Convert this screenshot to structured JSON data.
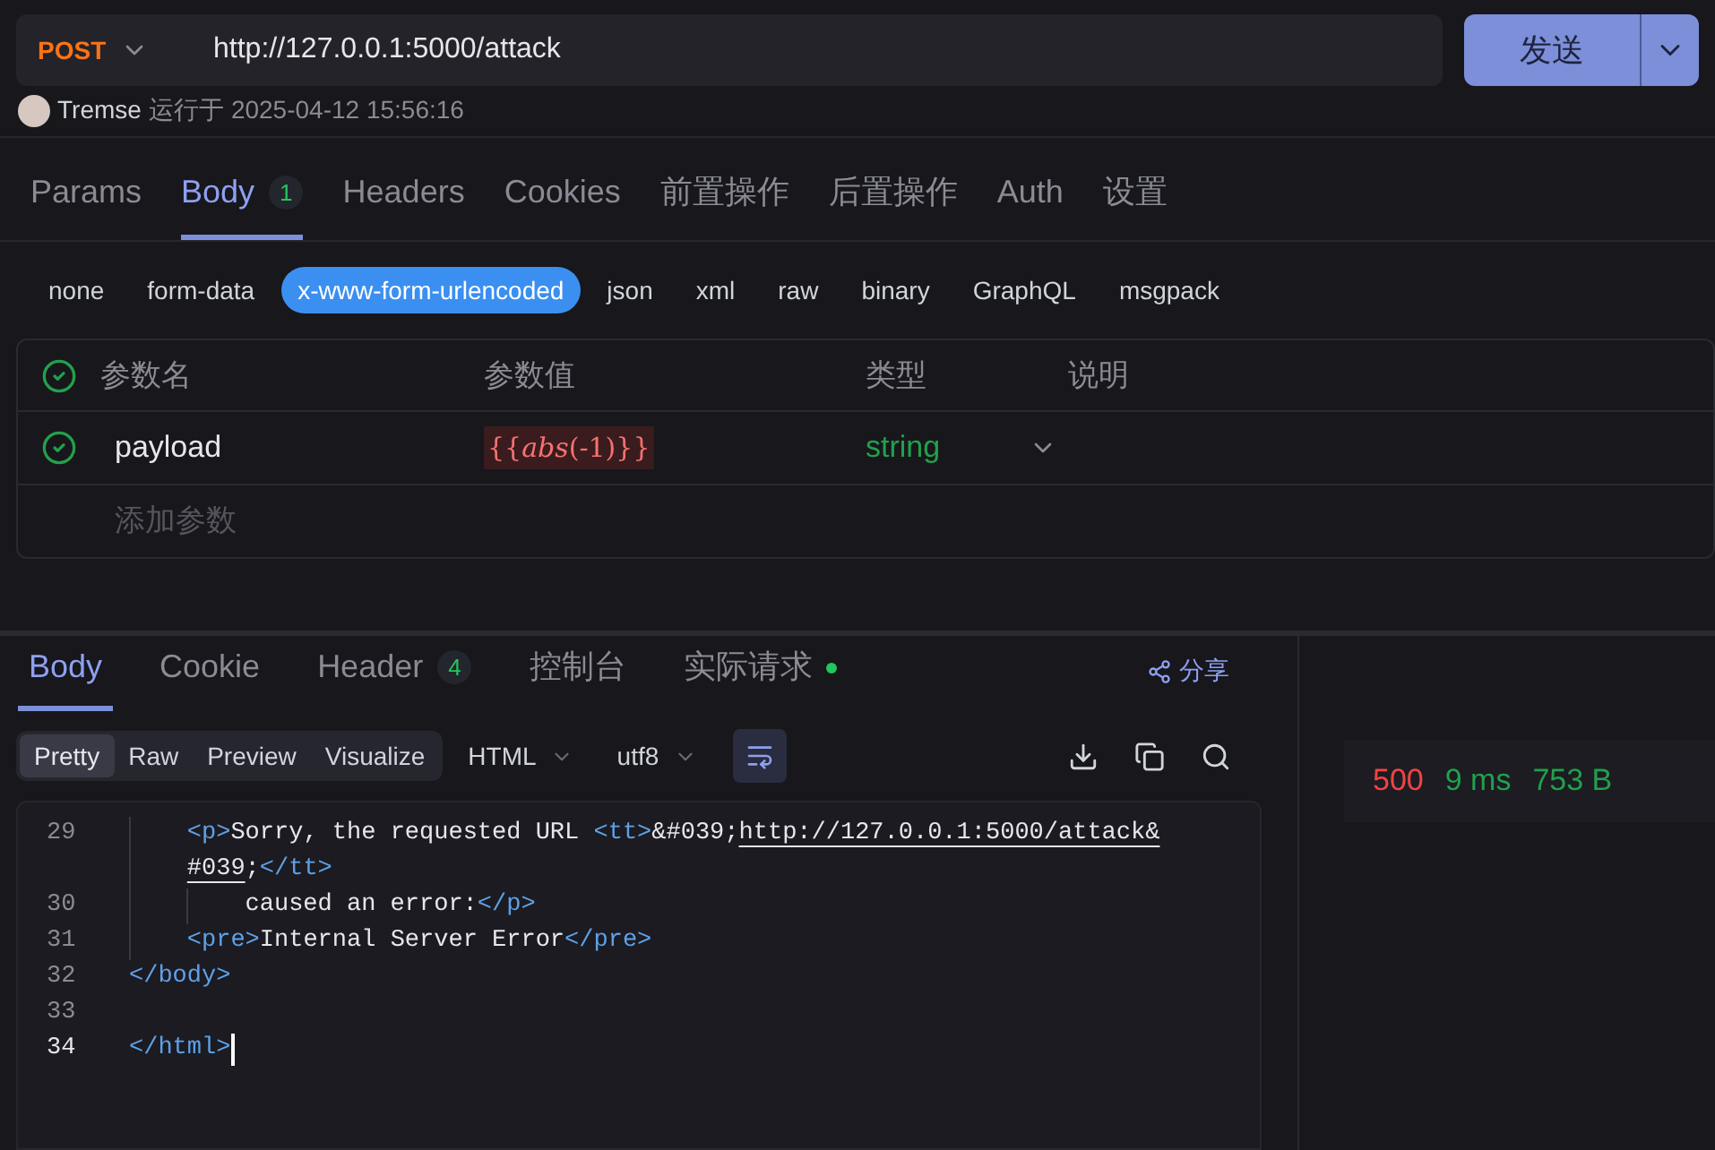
{
  "request": {
    "method": "POST",
    "url": "http://127.0.0.1:5000/attack",
    "send_label": "发送"
  },
  "run_info": {
    "user": "Tremse",
    "label": "运行于",
    "time": "2025-04-12 15:56:16"
  },
  "request_tabs": [
    {
      "label": "Params",
      "selected": false
    },
    {
      "label": "Body",
      "selected": true,
      "count": "1"
    },
    {
      "label": "Headers",
      "selected": false
    },
    {
      "label": "Cookies",
      "selected": false
    },
    {
      "label": "前置操作",
      "selected": false
    },
    {
      "label": "后置操作",
      "selected": false
    },
    {
      "label": "Auth",
      "selected": false
    },
    {
      "label": "设置",
      "selected": false
    }
  ],
  "body_types": [
    {
      "label": "none",
      "selected": false
    },
    {
      "label": "form-data",
      "selected": false
    },
    {
      "label": "x-www-form-urlencoded",
      "selected": true
    },
    {
      "label": "json",
      "selected": false
    },
    {
      "label": "xml",
      "selected": false
    },
    {
      "label": "raw",
      "selected": false
    },
    {
      "label": "binary",
      "selected": false
    },
    {
      "label": "GraphQL",
      "selected": false
    },
    {
      "label": "msgpack",
      "selected": false
    }
  ],
  "params_table": {
    "columns": [
      "参数名",
      "参数值",
      "类型",
      "说明"
    ],
    "all_checked": true,
    "rows": [
      {
        "checked": true,
        "name": "payload",
        "value": "{{*abs*(-1)}}",
        "type": "string"
      }
    ],
    "add_placeholder": "添加参数"
  },
  "response_tabs": [
    {
      "label": "Body",
      "selected": true
    },
    {
      "label": "Cookie",
      "selected": false
    },
    {
      "label": "Header",
      "selected": false,
      "count": "4"
    },
    {
      "label": "控制台",
      "selected": false
    },
    {
      "label": "实际请求",
      "selected": false,
      "dot": true
    }
  ],
  "share_label": "分享",
  "view_modes": [
    {
      "label": "Pretty",
      "selected": true
    },
    {
      "label": "Raw",
      "selected": false
    },
    {
      "label": "Preview",
      "selected": false
    },
    {
      "label": "Visualize",
      "selected": false
    }
  ],
  "format": "HTML",
  "encoding": "utf8",
  "wrap_on": true,
  "code_lines": [
    {
      "children": [
        {
          "number": "29",
          "tokens": [
            {
              "kind": "tag",
              "text": "<p>"
            },
            {
              "kind": "text",
              "text": "Sorry, the requested URL "
            },
            {
              "kind": "tag",
              "text": "<tt>"
            },
            {
              "kind": "text",
              "text": "&#039;"
            },
            {
              "kind": "link",
              "text": "http://127.0.0.1:5000/attack&"
            }
          ],
          "continuation": [
            {
              "kind": "link",
              "text": "#039"
            },
            {
              "kind": "text",
              "text": ";"
            },
            {
              "kind": "tag",
              "text": "</tt>"
            }
          ],
          "children": [
            {
              "number": "30",
              "tokens": [
                {
                  "kind": "text",
                  "text": "caused an error:"
                },
                {
                  "kind": "tag",
                  "text": "</p>"
                }
              ]
            }
          ]
        },
        {
          "number": "31",
          "tokens": [
            {
              "kind": "tag",
              "text": "<pre>"
            },
            {
              "kind": "text",
              "text": "Internal Server Error"
            },
            {
              "kind": "tag",
              "text": "</pre>"
            }
          ]
        }
      ]
    },
    {
      "number": "32",
      "tokens": [
        {
          "kind": "tag",
          "text": "</body>"
        }
      ]
    },
    {
      "number": "33"
    },
    {
      "number": "34",
      "current": true,
      "tokens": [
        {
          "kind": "tag",
          "text": "</html>"
        }
      ]
    }
  ],
  "status": {
    "code": "500",
    "time": "9 ms",
    "size": "753 B"
  }
}
